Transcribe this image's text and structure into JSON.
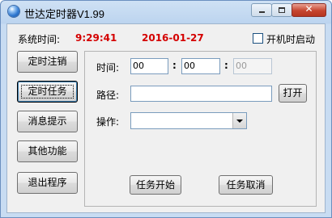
{
  "window": {
    "title": "世达定时器V1.99",
    "close_glyph": "✕"
  },
  "status": {
    "system_time_label": "系统时间:",
    "time": "9:29:41",
    "date": "2016-01-27",
    "autostart_label": "开机时启动",
    "autostart_checked": false
  },
  "nav": {
    "items": [
      {
        "label": "定时注销"
      },
      {
        "label": "定时任务"
      },
      {
        "label": "消息提示"
      },
      {
        "label": "其他功能"
      },
      {
        "label": "退出程序"
      }
    ],
    "active_index": 1
  },
  "task_panel": {
    "time_label": "时间:",
    "hour": "00",
    "minute": "00",
    "second": "00",
    "colon": ":",
    "path_label": "路径:",
    "path_value": "",
    "open_button": "打开",
    "action_label": "操作:",
    "action_value": "",
    "start_button": "任务开始",
    "cancel_button": "任务取消"
  },
  "colors": {
    "clock_red": "#d40000",
    "title_bar": "#bcd4ef",
    "close_button": "#c6452f"
  }
}
